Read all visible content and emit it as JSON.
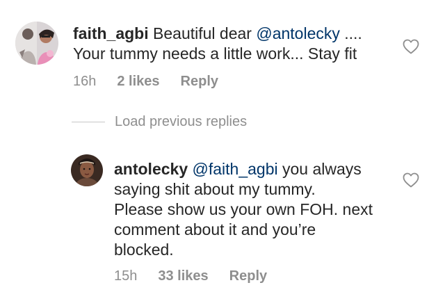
{
  "comments": [
    {
      "username": "faith_agbi",
      "text_parts": [
        " Beautiful dear ",
        "@antolecky",
        " ....\nYour tummy needs a little work... Stay fit"
      ],
      "time": "16h",
      "likes": "2 likes",
      "reply": "Reply"
    },
    {
      "username": "antolecky",
      "text_parts": [
        " ",
        "@faith_agbi",
        " you always\nsaying shit about my tummy.\nPlease show us your own FOH. next\ncomment about it and you’re\nblocked."
      ],
      "time": "15h",
      "likes": "33 likes",
      "reply": "Reply"
    }
  ],
  "load_replies": "Load previous replies",
  "colors": {
    "text": "#262626",
    "meta": "#8e8e8e",
    "mention": "#003569",
    "divider": "#c7c7c7"
  },
  "icons": {
    "like": "heart-outline-icon"
  }
}
